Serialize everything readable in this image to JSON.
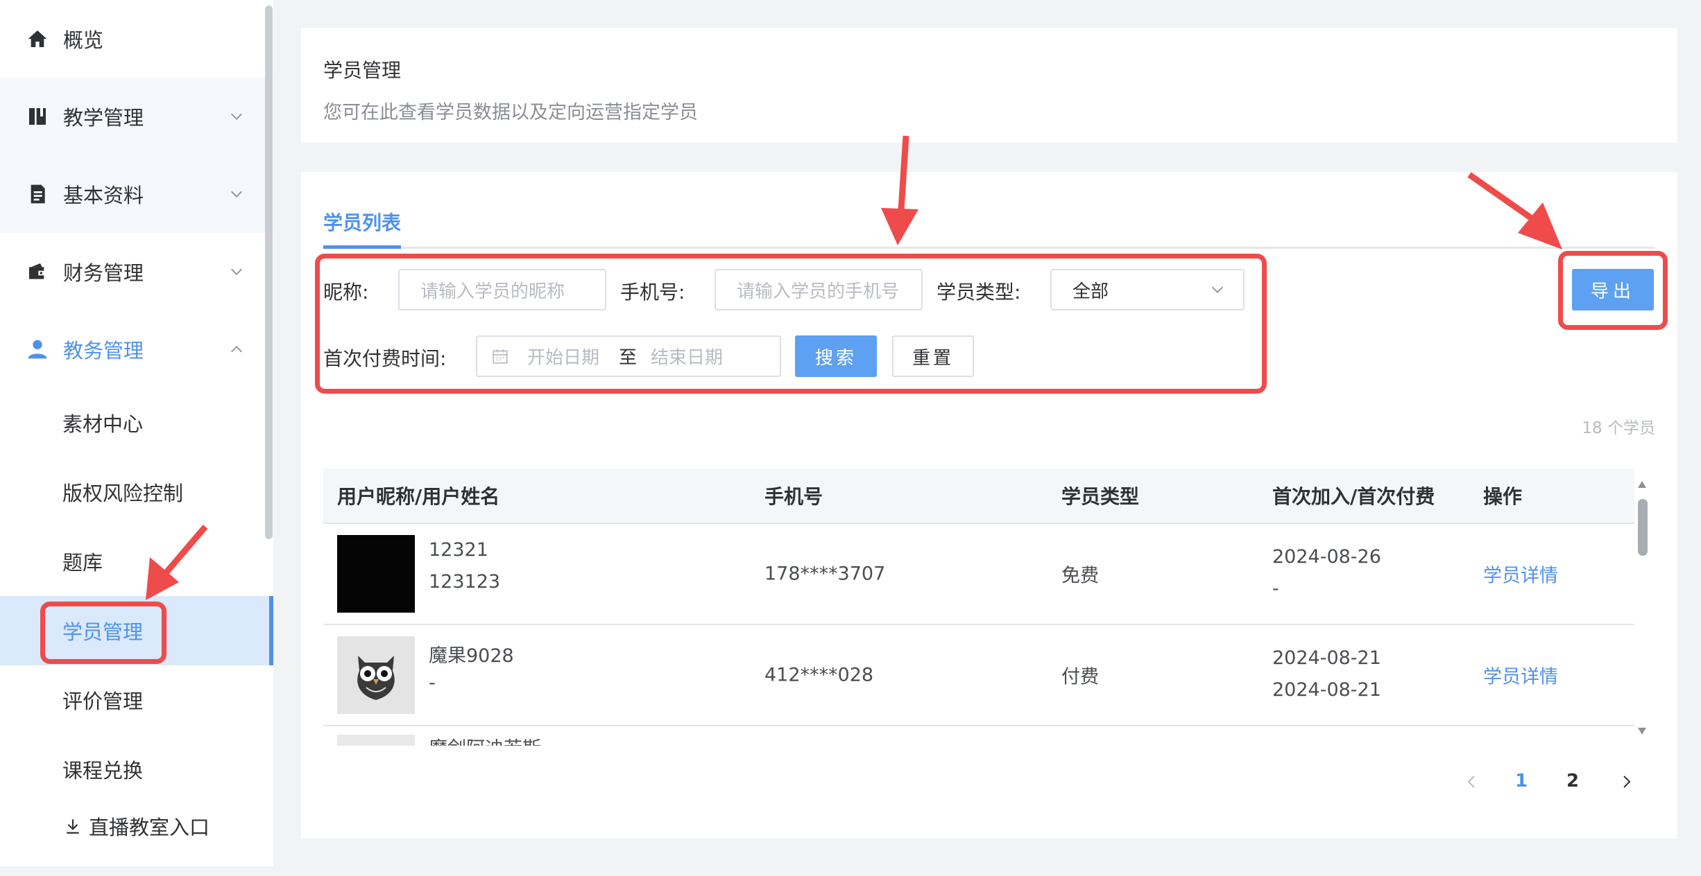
{
  "sidebar": {
    "items": [
      {
        "label": "概览",
        "icon": "home-icon"
      },
      {
        "label": "教学管理",
        "icon": "book-icon"
      },
      {
        "label": "基本资料",
        "icon": "document-icon"
      },
      {
        "label": "财务管理",
        "icon": "wallet-icon"
      },
      {
        "label": "教务管理",
        "icon": "user-icon"
      }
    ],
    "subitems": [
      "素材中心",
      "版权风险控制",
      "题库",
      "学员管理",
      "评价管理",
      "课程兑换"
    ],
    "live_entry": "直播教室入口",
    "active": "学员管理"
  },
  "header": {
    "title": "学员管理",
    "subtitle": "您可在此查看学员数据以及定向运营指定学员"
  },
  "tabs": [
    {
      "label": "学员列表",
      "active": true
    }
  ],
  "filters": {
    "nickname_label": "昵称:",
    "nickname_placeholder": "请输入学员的昵称",
    "phone_label": "手机号:",
    "phone_placeholder": "请输入学员的手机号",
    "type_label": "学员类型:",
    "type_value": "全部",
    "first_pay_label": "首次付费时间:",
    "start_placeholder": "开始日期",
    "range_sep": "至",
    "end_placeholder": "结束日期",
    "search_btn": "搜索",
    "reset_btn": "重置"
  },
  "export_btn": "导出",
  "count_text": "18 个学员",
  "table": {
    "headers": [
      "用户昵称/用户姓名",
      "手机号",
      "学员类型",
      "首次加入/首次付费",
      "操作"
    ],
    "rows": [
      {
        "nickname": "12321",
        "realname": "123123",
        "phone": "178****3707",
        "type": "免费",
        "joined": "2024-08-26",
        "first_pay": "-",
        "action": "学员详情"
      },
      {
        "nickname": "魔果9028",
        "realname": "-",
        "phone": "412****028",
        "type": "付费",
        "joined": "2024-08-21",
        "first_pay": "2024-08-21",
        "action": "学员详情"
      },
      {
        "nickname": "魔剑阿迪若斯"
      }
    ]
  },
  "pagination": {
    "pages": [
      "1",
      "2"
    ],
    "current": "1"
  },
  "colors": {
    "accent": "#4f92ea",
    "annotation": "#ef4b4b"
  }
}
